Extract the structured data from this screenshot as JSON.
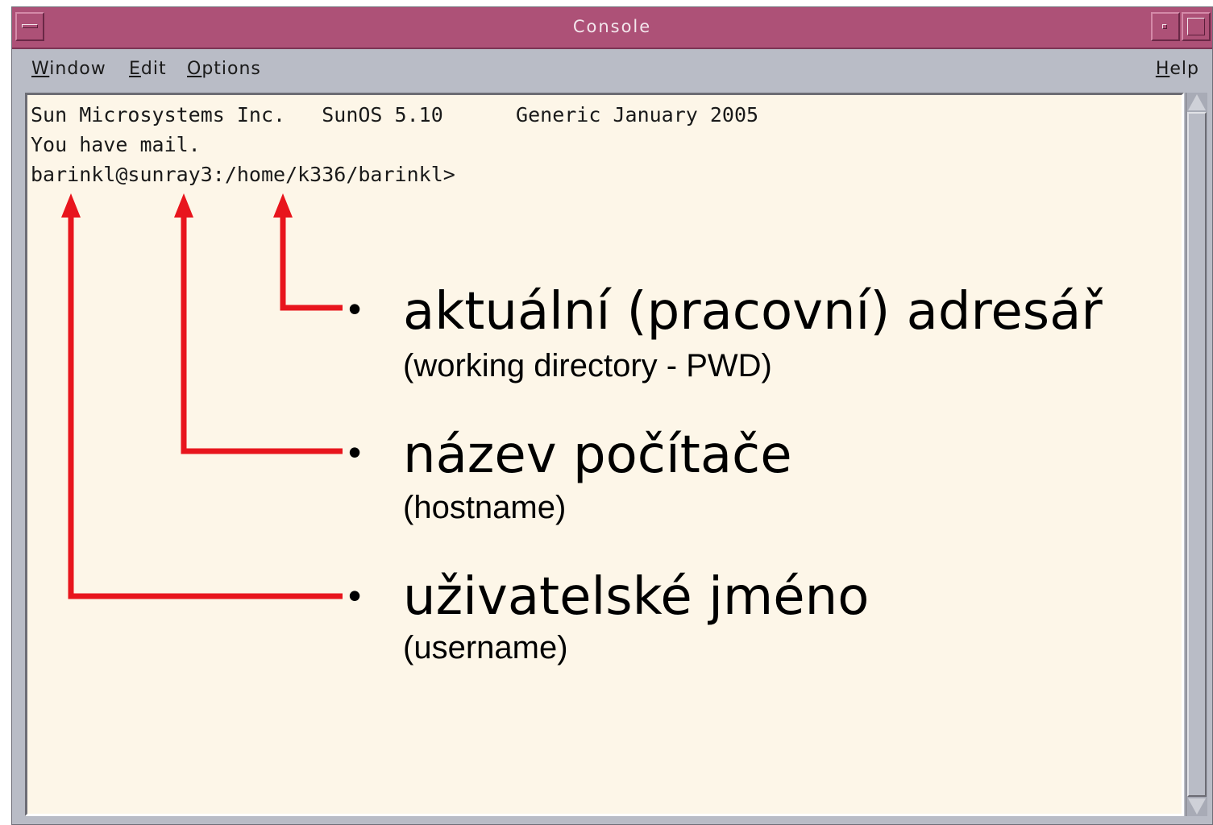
{
  "window": {
    "title": "Console"
  },
  "menubar": {
    "items": [
      {
        "mnemonic": "W",
        "rest": "indow"
      },
      {
        "mnemonic": "E",
        "rest": "dit"
      },
      {
        "mnemonic": "O",
        "rest": "ptions"
      }
    ],
    "help": {
      "mnemonic": "H",
      "rest": "elp"
    }
  },
  "terminal": {
    "lines": [
      "Sun Microsystems Inc.   SunOS 5.10      Generic January 2005",
      "You have mail.",
      "barinkl@sunray3:/home/k336/barinkl>"
    ]
  },
  "annotations": [
    {
      "bullet": "•",
      "label": "aktuální (pracovní) adresář",
      "sublabel": "(working directory - PWD)"
    },
    {
      "bullet": "•",
      "label": "název počítače",
      "sublabel": "(hostname)"
    },
    {
      "bullet": "•",
      "label": "uživatelské jméno",
      "sublabel": "(username)"
    }
  ],
  "colors": {
    "titlebar": "#ad5177",
    "terminal_bg": "#fdf6e8",
    "arrow": "#e8151d"
  }
}
